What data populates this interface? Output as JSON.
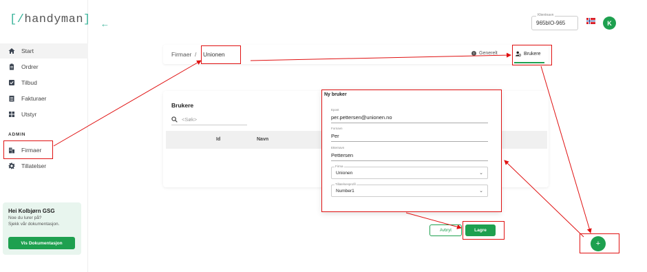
{
  "brand": {
    "bracket_open": "[/",
    "name": "handyman",
    "bracket_close": "]"
  },
  "nav": {
    "items": [
      {
        "label": "Start",
        "icon": "home-icon"
      },
      {
        "label": "Ordrer",
        "icon": "clipboard-icon"
      },
      {
        "label": "Tilbud",
        "icon": "checkbox-icon"
      },
      {
        "label": "Fakturaer",
        "icon": "invoice-icon"
      },
      {
        "label": "Utstyr",
        "icon": "grid-icon"
      }
    ],
    "admin_label": "ADMIN",
    "admin_items": [
      {
        "label": "Firmaer",
        "icon": "building-icon"
      },
      {
        "label": "Tillatelser",
        "icon": "gear-icon"
      }
    ]
  },
  "help": {
    "title": "Hei Kolbjørn GSG",
    "line1": "Noe du lurer på?",
    "line2": "Sjekk vår dokumentasjon.",
    "button": "Vis Dokumentasjon"
  },
  "header": {
    "client_label": "Klientnavn",
    "client_value": "965bIO-965",
    "avatar_initial": "K"
  },
  "breadcrumb": {
    "root": "Firmaer",
    "separator": "/",
    "current": "Unionen"
  },
  "tabs": {
    "general": "Generelt",
    "users": "Brukere"
  },
  "users_card": {
    "title": "Brukere",
    "search_placeholder": "<Søk>",
    "columns": [
      "Id",
      "Navn"
    ]
  },
  "dialog": {
    "title": "Ny bruker",
    "email": {
      "label": "Epost",
      "value": "per.pettersen@unionen.no"
    },
    "first_name": {
      "label": "Fornavn",
      "value": "Per"
    },
    "last_name": {
      "label": "Etternavn",
      "value": "Pettersen"
    },
    "company": {
      "label": "Firma",
      "value": "Unionen"
    },
    "permission": {
      "label": "Tillatelsesprofil",
      "value": "Number1"
    },
    "cancel": "Avbryt",
    "save": "Lagre"
  },
  "fab": {
    "label": "+"
  },
  "colors": {
    "accent": "#1ea04f",
    "teal": "#3ab39a",
    "annotation": "#e01010"
  }
}
